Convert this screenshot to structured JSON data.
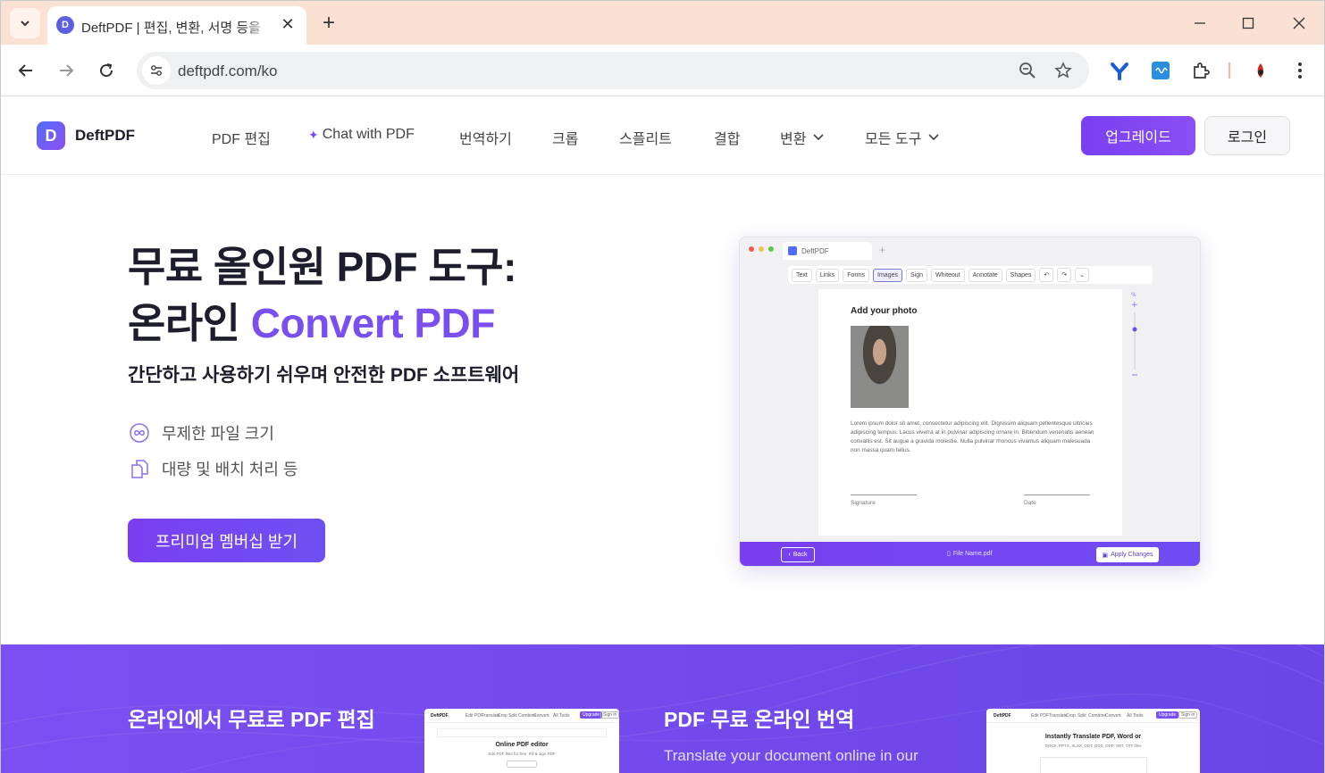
{
  "browser": {
    "tab_title": "DeftPDF | 편집, 변환, 서명 등을",
    "tab_favicon_letter": "D",
    "url": "deftpdf.com/ko"
  },
  "header": {
    "logo_letter": "D",
    "logo_text": "DeftPDF",
    "menu": [
      "PDF 편집",
      "Chat with PDF",
      "번역하기",
      "크롭",
      "스플리트",
      "결합",
      "변환",
      "모든 도구"
    ],
    "upgrade_label": "업그레이드",
    "login_label": "로그인"
  },
  "hero": {
    "title_line1": "무료 올인원 PDF 도구:",
    "title_line2_prefix": "온라인 ",
    "title_line2_accent": "Convert PDF",
    "subtitle": "간단하고 사용하기 쉬우며 안전한 PDF 소프트웨어",
    "features": [
      "무제한 파일 크기",
      "대량 및 배치 처리 등"
    ],
    "cta_label": "프리미엄 멤버십 받기"
  },
  "mockup": {
    "tab_label": "DeftPDF",
    "tools": [
      "Text",
      "Links",
      "Forms",
      "Images",
      "Sign",
      "Whiteout",
      "Annotate",
      "Shapes"
    ],
    "selected_tool": "Images",
    "page_heading": "Add your photo",
    "body_text": "Lorem ipsum dolor sit amet, consectetur adipiscing elit. Dignissim aliquam pellentesque ultricies adipiscing tempus. Lacus viverra at in pulvinar adipiscing ornare in. Bibendum venenatis aenean convallis est. Sit augue a gravida molestie. Nulla pulvinar rhoncus vivamus aliquam malesuada non massa quam tellus.",
    "signature_label": "Signature",
    "date_label": "Date",
    "back_label": "Back",
    "file_name": "File Name.pdf",
    "apply_label": "Apply Changes"
  },
  "sections": {
    "edit_title": "온라인에서 무료로 PDF 편집",
    "edit_card": {
      "heading": "Online PDF editor",
      "sub": "Edit PDF files for free. Fill & sign PDF",
      "nav": [
        "Edit PDF",
        "Translate",
        "Crop",
        "Split",
        "Combine",
        "Convert",
        "All Tools"
      ],
      "upgrade": "Upgrade",
      "sign_in": "Sign in",
      "logo": "DeftPDF"
    },
    "translate_title": "PDF 무료 온라인 번역",
    "translate_sub": "Translate your document online in our",
    "translate_card": {
      "heading": "Instantly Translate PDF, Word or",
      "sub": "DOCX, PPTX, XLSX, ODT, ODS, ODP, SRT, TXT files",
      "nav": [
        "Edit PDF",
        "Translate",
        "Crop",
        "Split",
        "Combine",
        "Convert",
        "All Tools"
      ],
      "upgrade": "Upgrade",
      "sign_in": "Sign in",
      "logo": "DeftPDF"
    }
  },
  "colors": {
    "accent": "#7a4ff0",
    "tabbar": "#fbe1d3",
    "purple_section": "#7348ec"
  }
}
